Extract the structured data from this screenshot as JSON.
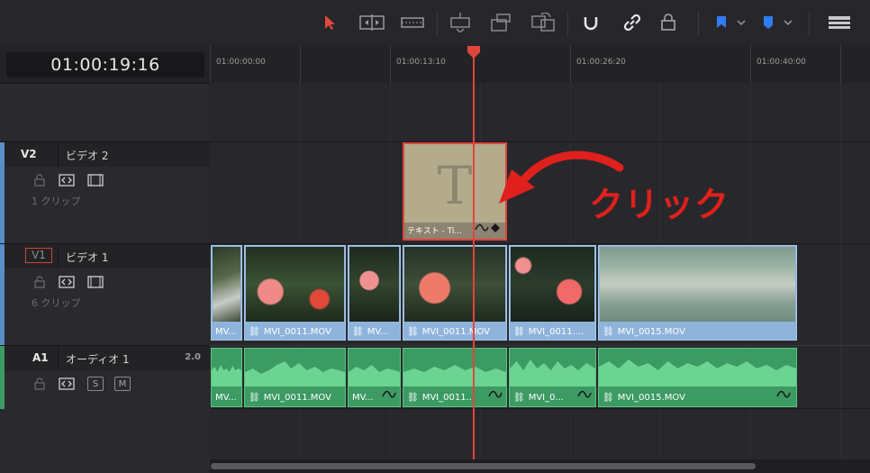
{
  "toolbar": {
    "icons": [
      "select-arrow-icon",
      "trim-edit-icon",
      "dynamic-trim-icon",
      "insert-clip-icon",
      "overwrite-clip-icon",
      "replace-clip-icon",
      "snapping-icon",
      "linked-selection-icon",
      "position-lock-icon",
      "flag-icon",
      "marker-icon",
      "timeline-view-options-icon"
    ],
    "accent": "#e8453c"
  },
  "timecode": "01:00:19:16",
  "ruler": {
    "labels": [
      "01:00:00:00",
      "01:00:13:10",
      "01:00:26:20",
      "01:00:40:00"
    ]
  },
  "tracks": {
    "v2": {
      "code": "V2",
      "name": "ビデオ 2",
      "clips": "1 クリップ"
    },
    "v1": {
      "code": "V1",
      "name": "ビデオ 1",
      "clips": "6 クリップ"
    },
    "a1": {
      "code": "A1",
      "name": "オーディオ 1",
      "channels": "2.0",
      "solo": "S",
      "mute": "M"
    }
  },
  "title_clip": {
    "glyph": "T",
    "label": "テキスト - Ti..."
  },
  "annotation": "クリック",
  "video_clips": [
    "MV...",
    "MVI_0011.MOV",
    "MV...",
    "MVI_0011.MOV",
    "MVI_0011....",
    "MVI_0015.MOV"
  ],
  "audio_clips": [
    "MV...",
    "MVI_0011.MOV",
    "MV...",
    "MVI_0011...",
    "MVI_0...",
    "MVI_0015.MOV"
  ],
  "colors": {
    "video_clip": "#8fb4dc",
    "audio_clip": "#3b9b62",
    "playhead": "#e8453c",
    "title_clip": "#b4aa8c"
  }
}
